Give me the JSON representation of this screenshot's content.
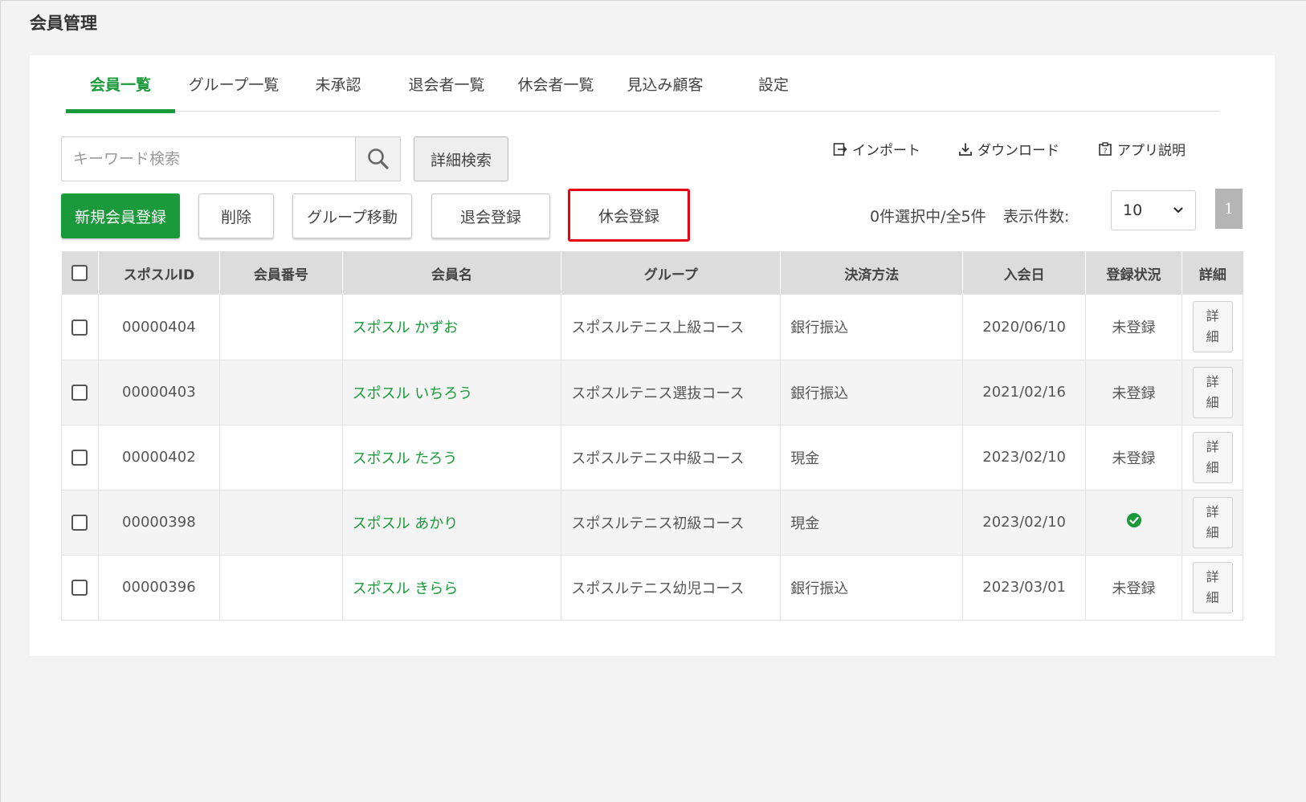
{
  "page": {
    "title": "会員管理"
  },
  "tabs": [
    {
      "label": "会員一覧"
    },
    {
      "label": "グループ一覧"
    },
    {
      "label": "未承認"
    },
    {
      "label": "退会者一覧"
    },
    {
      "label": "休会者一覧"
    },
    {
      "label": "見込み顧客"
    },
    {
      "label": "設定"
    }
  ],
  "search": {
    "placeholder": "キーワード検索",
    "advanced_label": "詳細検索"
  },
  "links": {
    "import": "インポート",
    "download": "ダウンロード",
    "app_help": "アプリ説明"
  },
  "actions": {
    "new_member": "新規会員登録",
    "delete": "削除",
    "group_move": "グループ移動",
    "withdraw": "退会登録",
    "suspend": "休会登録"
  },
  "selection": {
    "count_text": "0件選択中/全5件",
    "perpage_label": "表示件数:",
    "perpage_value": "10",
    "current_page": "1"
  },
  "table": {
    "headers": {
      "id": "スポスルID",
      "number": "会員番号",
      "name": "会員名",
      "group": "グループ",
      "payment": "決済方法",
      "joined": "入会日",
      "status": "登録状況",
      "detail": "詳細"
    },
    "detail_label_1": "詳",
    "detail_label_2": "細",
    "rows": [
      {
        "id": "00000404",
        "number": "",
        "name": "スポスル かずお",
        "group": "スポスルテニス上級コース",
        "payment": "銀行振込",
        "joined": "2020/06/10",
        "status": "未登録"
      },
      {
        "id": "00000403",
        "number": "",
        "name": "スポスル いちろう",
        "group": "スポスルテニス選抜コース",
        "payment": "銀行振込",
        "joined": "2021/02/16",
        "status": "未登録"
      },
      {
        "id": "00000402",
        "number": "",
        "name": "スポスル たろう",
        "group": "スポスルテニス中級コース",
        "payment": "現金",
        "joined": "2023/02/10",
        "status": "未登録"
      },
      {
        "id": "00000398",
        "number": "",
        "name": "スポスル あかり",
        "group": "スポスルテニス初級コース",
        "payment": "現金",
        "joined": "2023/02/10",
        "status": ""
      },
      {
        "id": "00000396",
        "number": "",
        "name": "スポスル きらら",
        "group": "スポスルテニス幼児コース",
        "payment": "銀行振込",
        "joined": "2023/03/01",
        "status": "未登録"
      }
    ]
  },
  "colors": {
    "accent": "#1a9a3a",
    "highlight": "#e60012"
  }
}
